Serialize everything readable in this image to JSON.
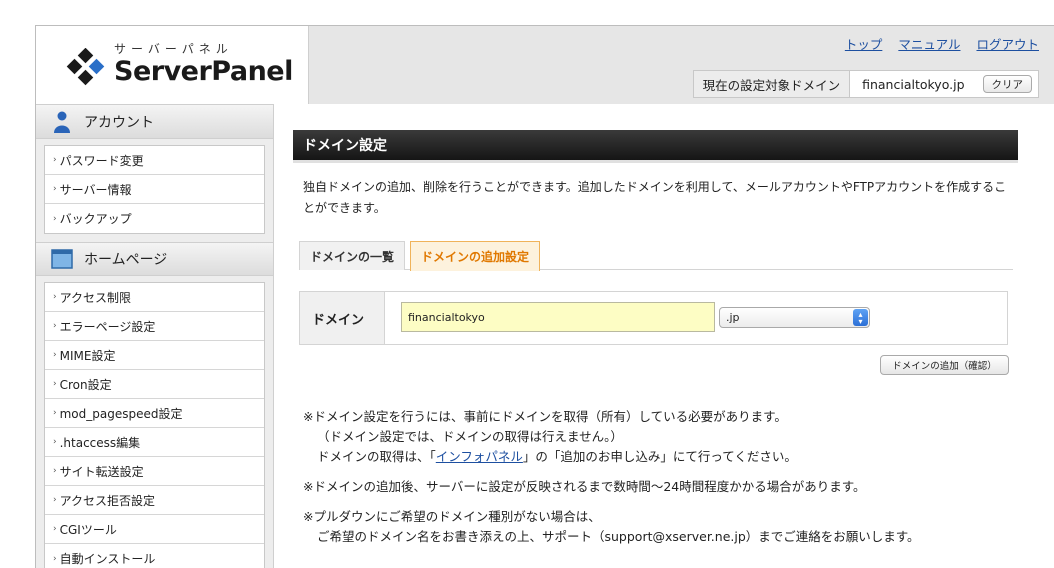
{
  "header": {
    "logo_kana": "サーバーパネル",
    "logo_name": "ServerPanel",
    "links": [
      "トップ",
      "マニュアル",
      "ログアウト"
    ],
    "domain_label": "現在の設定対象ドメイン",
    "domain_value": "financialtokyo.jp",
    "clear_label": "クリア"
  },
  "sidebar": {
    "account_title": "アカウント",
    "account_items": [
      "パスワード変更",
      "サーバー情報",
      "バックアップ"
    ],
    "homepage_title": "ホームページ",
    "homepage_items": [
      "アクセス制限",
      "エラーページ設定",
      "MIME設定",
      "Cron設定",
      "mod_pagespeed設定",
      ".htaccess編集",
      "サイト転送設定",
      "アクセス拒否設定",
      "CGIツール",
      "自動インストール"
    ],
    "arrow_glyph": "›"
  },
  "main": {
    "title": "ドメイン設定",
    "description": "独自ドメインの追加、削除を行うことができます。追加したドメインを利用して、メールアカウントやFTPアカウントを作成することができます。",
    "tabs": [
      "ドメインの一覧",
      "ドメインの追加設定"
    ],
    "active_tab": 1,
    "form": {
      "label": "ドメイン",
      "input_value": "financialtokyo",
      "select_value": ".jp"
    },
    "confirm_button": "ドメインの追加（確認）",
    "notes": {
      "n1_line1": "※ドメイン設定を行うには、事前にドメインを取得（所有）している必要があります。",
      "n1_line2": "（ドメイン設定では、ドメインの取得は行えません。）",
      "n1_line3_pre": "ドメインの取得は、「",
      "n1_line3_link": "インフォパネル",
      "n1_line3_post": "」の「追加のお申し込み」にて行ってください。",
      "n2": "※ドメインの追加後、サーバーに設定が反映されるまで数時間〜24時間程度かかる場合があります。",
      "n3_line1": "※プルダウンにご希望のドメイン種別がない場合は、",
      "n3_line2": "ご希望のドメイン名をお書き添えの上、サポート（support@xserver.ne.jp）までご連絡をお願いします。"
    }
  },
  "colors": {
    "link": "#1d4fa0",
    "active_tab_text": "#e07800",
    "input_bg": "#fdfdc4",
    "title_bar": "#1e1e1e"
  }
}
